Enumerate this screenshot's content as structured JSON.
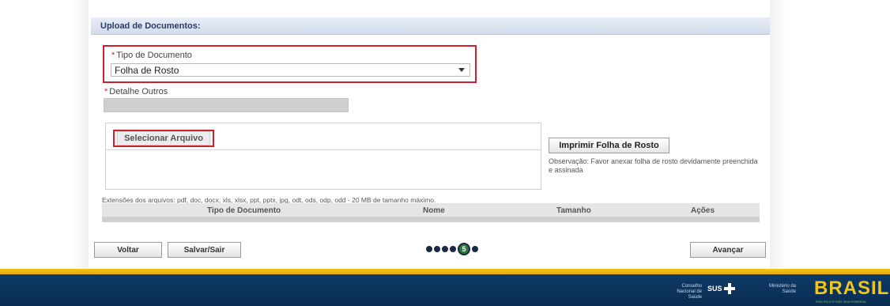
{
  "section": {
    "title": "Upload de Documentos:"
  },
  "form": {
    "required_mark": "*",
    "tipo_label": "Tipo de Documento",
    "tipo_value": "Folha de Rosto",
    "detalhe_label": "Detalhe Outros"
  },
  "upload": {
    "select_button": "Selecionar Arquivo",
    "print_button": "Imprimir Folha de Rosto",
    "observacao": "Observação: Favor anexar folha de rosto devidamente preenchida e assinada",
    "extensions": "Extensões dos arquivos: pdf, doc, docx, xls, xlsx, ppt, pptx, jpg, odt, ods, odp, odd - 20 MB de tamanho máximo."
  },
  "table": {
    "columns": [
      "Tipo de Documento",
      "Nome",
      "Tamanho",
      "Ações"
    ]
  },
  "nav": {
    "back": "Voltar",
    "save_exit": "Salvar/Sair",
    "next": "Avançar",
    "current_step": "5"
  },
  "footer": {
    "conselho": "Conselho Nacional de Saúde",
    "sus": "SUS",
    "ministerio": "Ministério da Saúde",
    "brasil": "BRASIL",
    "brasil_sub": "PAÍS RICO É PAÍS SEM POBREZA"
  },
  "colors": {
    "highlight": "#c9222e",
    "header_bg": "#d3dcec",
    "footer_bg": "#0d3a66",
    "footer_stripe": "#f2c51a",
    "active_step": "#2b7a3c"
  }
}
